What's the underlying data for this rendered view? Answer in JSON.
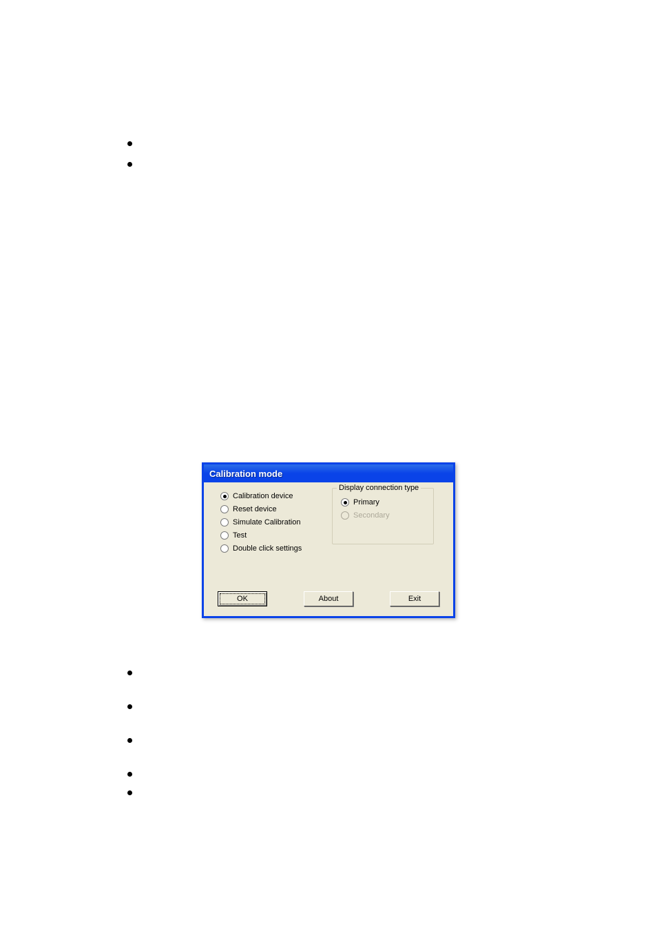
{
  "dialog": {
    "title": "Calibration mode",
    "options": [
      {
        "label": "Calibration device",
        "checked": true
      },
      {
        "label": "Reset device",
        "checked": false
      },
      {
        "label": "Simulate Calibration",
        "checked": false
      },
      {
        "label": "Test",
        "checked": false
      },
      {
        "label": "Double click settings",
        "checked": false
      }
    ],
    "groupbox": {
      "title": "Display connection type",
      "options": [
        {
          "label": "Primary",
          "checked": true,
          "disabled": false
        },
        {
          "label": "Secondary",
          "checked": false,
          "disabled": true
        }
      ]
    },
    "buttons": {
      "ok": "OK",
      "about": "About",
      "exit": "Exit"
    }
  }
}
